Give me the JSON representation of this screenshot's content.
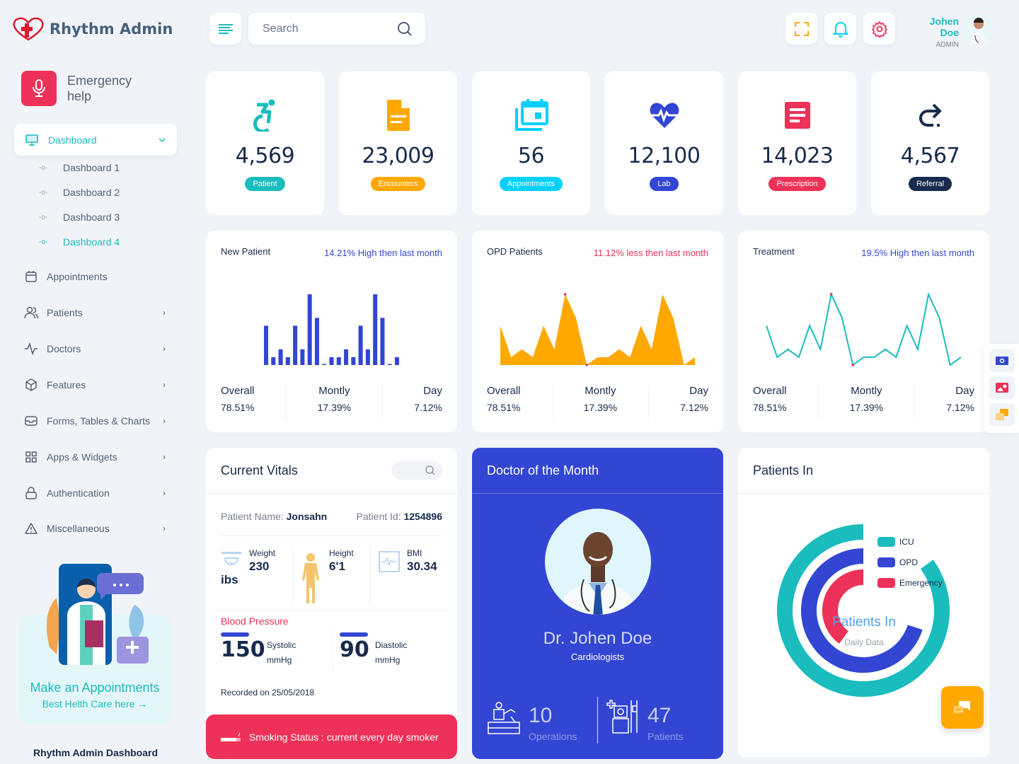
{
  "app": {
    "title": "Rhythm Admin",
    "footer_title": "Rhythm Admin Dashboard"
  },
  "header": {
    "search_placeholder": "Search",
    "user": {
      "name": "Johen Doe",
      "role": "ADMIN"
    }
  },
  "sidebar": {
    "emergency_label": "Emergency help",
    "active": {
      "label": "Dashboard",
      "sub_items": [
        "Dashboard 1",
        "Dashboard 2",
        "Dashboard 3",
        "Dashboard 4"
      ],
      "active_sub": "Dashboard 4"
    },
    "items": [
      {
        "label": "Appointments",
        "icon": "calendar-icon",
        "has_children": false
      },
      {
        "label": "Patients",
        "icon": "users-icon",
        "has_children": true
      },
      {
        "label": "Doctors",
        "icon": "activity-icon",
        "has_children": true
      },
      {
        "label": "Features",
        "icon": "box-icon",
        "has_children": true
      },
      {
        "label": "Forms, Tables & Charts",
        "icon": "inbox-icon",
        "has_children": true
      },
      {
        "label": "Apps & Widgets",
        "icon": "grid-icon",
        "has_children": true
      },
      {
        "label": "Authentication",
        "icon": "lock-icon",
        "has_children": true
      },
      {
        "label": "Miscellaneous",
        "icon": "alert-triangle-icon",
        "has_children": true
      }
    ],
    "promo": {
      "title": "Make an Appointments",
      "link": "Best Helth Care here →"
    }
  },
  "stats": [
    {
      "value": "4,569",
      "label": "Patient",
      "color": "#1bbcbd",
      "icon": "wheelchair-icon"
    },
    {
      "value": "23,009",
      "label": "Encounters",
      "color": "#ffa800",
      "icon": "document-icon"
    },
    {
      "value": "56",
      "label": "Appointments",
      "color": "#04d0ff",
      "icon": "calendar-stack-icon"
    },
    {
      "value": "12,100",
      "label": "Lab",
      "color": "#3246d3",
      "icon": "heart-pulse-icon"
    },
    {
      "value": "14,023",
      "label": "Prescription",
      "color": "#ee3158",
      "icon": "prescription-icon"
    },
    {
      "value": "4,567",
      "label": "Referral",
      "color": "#172b4c",
      "icon": "redo-arrow-icon"
    }
  ],
  "charts": [
    {
      "title": "New Patient",
      "trend": "14.21% High then last month",
      "trend_color": "#3246d3",
      "overall": "78.51%",
      "monthly": "17.39%",
      "day": "7.12%"
    },
    {
      "title": "OPD Patients",
      "trend": "11.12% less then last month",
      "trend_color": "#ee3158",
      "overall": "78.51%",
      "monthly": "17.39%",
      "day": "7.12%"
    },
    {
      "title": "Treatment",
      "trend": "19.5% High then last month",
      "trend_color": "#3246d3",
      "overall": "78.51%",
      "monthly": "17.39%",
      "day": "7.12%"
    }
  ],
  "footer_labels": {
    "overall": "Overall",
    "monthly": "Montly",
    "day": "Day"
  },
  "chart_data": [
    {
      "type": "bar",
      "title": "New Patient",
      "color": "#3246d3",
      "values": [
        5,
        1,
        2,
        1,
        5,
        2,
        9,
        6,
        0,
        1,
        1,
        2,
        1,
        5,
        2,
        9,
        6,
        0,
        1
      ],
      "ylim": [
        0,
        9
      ]
    },
    {
      "type": "area",
      "title": "OPD Patients",
      "color": "#ffa800",
      "values": [
        5,
        1,
        2,
        1,
        5,
        2,
        9,
        6,
        0,
        1,
        1,
        2,
        1,
        5,
        2,
        9,
        6,
        0,
        1
      ],
      "ylim": [
        0,
        9
      ]
    },
    {
      "type": "line",
      "title": "Treatment",
      "color": "#1bbcbd",
      "values": [
        5,
        1,
        2,
        1,
        5,
        2,
        9,
        6,
        0,
        1,
        1,
        2,
        1,
        5,
        2,
        9,
        6,
        0,
        1
      ],
      "ylim": [
        0,
        9
      ]
    },
    {
      "type": "pie",
      "title": "Patients In",
      "subtitle": "Daily Data",
      "series": [
        {
          "name": "ICU",
          "value": 85,
          "color": "#1bbcbd"
        },
        {
          "name": "OPD",
          "value": 70,
          "color": "#3246d3"
        },
        {
          "name": "Emergency",
          "value": 40,
          "color": "#ee3158"
        }
      ],
      "max": 100,
      "legend": "top-right"
    }
  ],
  "vitals": {
    "title": "Current Vitals",
    "patient_name_label": "Patient Name:",
    "patient_name": "Jonsahn",
    "patient_id_label": "Patient Id:",
    "patient_id": "1254896",
    "weight_label": "Weight",
    "weight": "230",
    "weight_unit": "ibs",
    "height_label": "Height",
    "height": "6'1",
    "bmi_label": "BMI",
    "bmi": "30.34",
    "bp_label": "Blood Pressure",
    "systolic": "150",
    "systolic_label": "Systolic",
    "diastolic": "90",
    "diastolic_label": "Diastolic",
    "unit": "mmHg",
    "recorded": "Recorded on 25/05/2018",
    "smoking": "Smoking Status : current every day smoker"
  },
  "doctor": {
    "title": "Doctor of the Month",
    "name": "Dr. Johen Doe",
    "specialty": "Cardiologists",
    "operations": "10",
    "operations_label": "Operations",
    "patients": "47",
    "patients_label": "Patients"
  },
  "patients_in": {
    "title": "Patients In",
    "center_title": "Patients In",
    "center_sub": "Daily Data"
  }
}
